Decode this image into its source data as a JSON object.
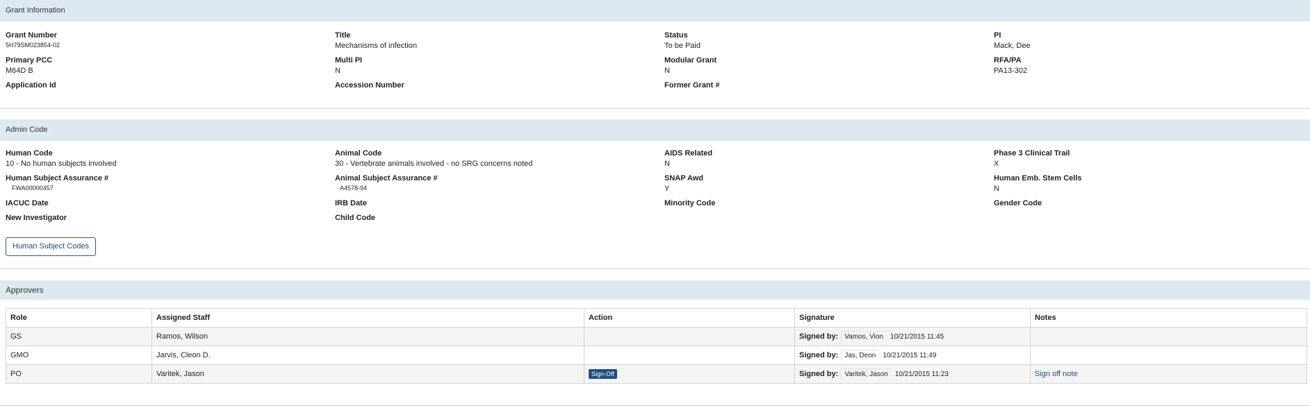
{
  "grant_info": {
    "header": "Grant Information",
    "fields": [
      {
        "label": "Grant Number",
        "value": "5H79SM023854-02"
      },
      {
        "label": "Title",
        "value": "Mechanisms of  infection"
      },
      {
        "label": "Status",
        "value": "To be Paid"
      },
      {
        "label": "PI",
        "value": "Mack, Dee"
      },
      {
        "label": "Primary PCC",
        "value": "M64D B"
      },
      {
        "label": "Multi PI",
        "value": "N"
      },
      {
        "label": "Modular Grant",
        "value": "N"
      },
      {
        "label": "RFA/PA",
        "value": "PA13-302"
      },
      {
        "label": "Application Id",
        "value": ""
      },
      {
        "label": "Accession Number",
        "value": ""
      },
      {
        "label": "Former Grant #",
        "value": ""
      }
    ]
  },
  "admin_code": {
    "header": "Admin Code",
    "fields": [
      {
        "label": "Human Code",
        "value": "10 - No human subjects involved"
      },
      {
        "label": "Animal Code",
        "value": "30 - Vertebrate animals involved - no SRG concerns noted"
      },
      {
        "label": "AIDS Related",
        "value": "N"
      },
      {
        "label": "Phase 3 Clinical Trail",
        "value": "X"
      },
      {
        "label": "Human Subject Assurance #",
        "value": "FWA00000457"
      },
      {
        "label": "Animal Subject Assurance #",
        "value": "A4578-94"
      },
      {
        "label": "SNAP Awd",
        "value": "Y"
      },
      {
        "label": "Human Emb. Stem Cells",
        "value": "N"
      },
      {
        "label": "IACUC Date",
        "value": ""
      },
      {
        "label": "IRB Date",
        "value": ""
      },
      {
        "label": "Minority Code",
        "value": ""
      },
      {
        "label": "Gender Code",
        "value": ""
      },
      {
        "label": "New Investigator",
        "value": ""
      },
      {
        "label": "Child Code",
        "value": ""
      }
    ],
    "button_label": "Human Subject Codes"
  },
  "approvers": {
    "header": "Approvers",
    "columns": [
      "Role",
      "Assigned Staff",
      "Action",
      "Signature",
      "Notes"
    ],
    "signed_by_label": "Signed by:",
    "rows": [
      {
        "role": "GS",
        "staff": "Ramos, Wilson",
        "action": "",
        "signer": "Vamos,  Vion",
        "time": "10/21/2015 11:45",
        "notes": ""
      },
      {
        "role": "GMO",
        "staff": " Jarvis, Cleon D.",
        "action": "",
        "signer": "Jas, Deon",
        "time": "10/21/2015 11:49",
        "notes": ""
      },
      {
        "role": "PO",
        "staff": "  Varitek, Jason",
        "action": "Sign-Off",
        "signer": "Varitek, Jason",
        "time": "10/21/2015 11:23",
        "notes": "Sign off note"
      }
    ]
  }
}
